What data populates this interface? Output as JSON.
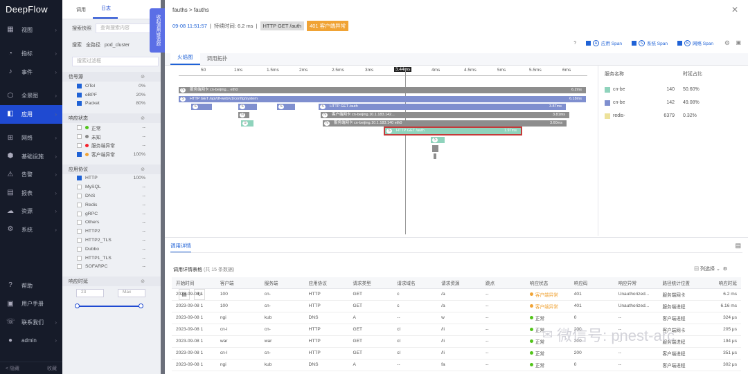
{
  "nav": {
    "logo": "DeepFlow",
    "items": [
      {
        "label": "视图",
        "icon": "dashboard-icon",
        "active": false
      },
      {
        "label": "指标",
        "icon": "gauge-icon",
        "active": false
      },
      {
        "label": "事件",
        "icon": "bell-icon",
        "active": false
      },
      {
        "label": "全景图",
        "icon": "graph-icon",
        "active": false
      },
      {
        "label": "应用",
        "icon": "app-icon",
        "active": true
      },
      {
        "label": "网络",
        "icon": "network-icon",
        "active": false
      },
      {
        "label": "基础设施",
        "icon": "cube-icon",
        "active": false
      },
      {
        "label": "告警",
        "icon": "warning-icon",
        "active": false
      },
      {
        "label": "报表",
        "icon": "report-icon",
        "active": false
      },
      {
        "label": "资源",
        "icon": "cloud-icon",
        "active": false
      },
      {
        "label": "系统",
        "icon": "gear-icon",
        "active": false
      }
    ],
    "bottom": [
      {
        "label": "帮助",
        "icon": "help-icon"
      },
      {
        "label": "用户手册",
        "icon": "book-icon"
      },
      {
        "label": "联系我们",
        "icon": "contact-icon"
      },
      {
        "label": "admin",
        "icon": "user-icon"
      }
    ],
    "footer_left": "< 隐藏",
    "footer_right": "收藏"
  },
  "filter": {
    "tabs": [
      "调用",
      "日志"
    ],
    "search_label": "搜索快照",
    "search_placeholder": "查询搜索内容",
    "group_label": "搜索",
    "group_path": "全路径",
    "group_value": "pod_cluster",
    "quick_placeholder": "搜索过滤框",
    "sections": [
      {
        "title": "信号源",
        "items": [
          {
            "label": "OTel",
            "pct": "0%",
            "checked": true
          },
          {
            "label": "eBPF",
            "pct": "20%",
            "checked": true
          },
          {
            "label": "Packet",
            "pct": "80%",
            "checked": true
          }
        ]
      },
      {
        "title": "响应状态",
        "items": [
          {
            "label": "正常",
            "pct": "--",
            "dot": "#52c41a"
          },
          {
            "label": "未知",
            "pct": "--",
            "dot": "#888888"
          },
          {
            "label": "服务端异常",
            "pct": "--",
            "dot": "#f5222d"
          },
          {
            "label": "客户端异常",
            "pct": "100%",
            "dot": "#f0a335",
            "checked": true
          }
        ]
      },
      {
        "title": "应用协议",
        "items": [
          {
            "label": "HTTP",
            "pct": "100%",
            "checked": true
          },
          {
            "label": "MySQL",
            "pct": "--"
          },
          {
            "label": "DNS",
            "pct": "--"
          },
          {
            "label": "Redis",
            "pct": "--"
          },
          {
            "label": "gRPC",
            "pct": "--"
          },
          {
            "label": "Others",
            "pct": "--"
          },
          {
            "label": "HTTP2",
            "pct": "--"
          },
          {
            "label": "HTTP2_TLS",
            "pct": "--"
          },
          {
            "label": "Dubbo",
            "pct": "--"
          },
          {
            "label": "HTTP1_TLS",
            "pct": "--"
          },
          {
            "label": "SOFARPC",
            "pct": "--"
          }
        ]
      },
      {
        "title": "响应时延",
        "items": []
      }
    ],
    "latency_min": "23",
    "latency_max": "Max"
  },
  "drawer_toggle": "收起调用链追踪",
  "panel": {
    "crumb": "fauths > fauths",
    "timestamp": "09-08 11:51:57",
    "duration": "持续时间: 6.2 ms",
    "request": "HTTP GET /auth",
    "status": "401 客户端异常",
    "legend": [
      {
        "badge": "A",
        "label": "应用 Span"
      },
      {
        "badge": "S",
        "label": "系统 Span"
      },
      {
        "badge": "N",
        "label": "网络 Span"
      }
    ],
    "tabs": [
      "火焰图",
      "调用拓扑"
    ],
    "ticks": [
      "50",
      "1ms",
      "1.5ms",
      "2ms",
      "2.5ms",
      "3ms",
      "3.44ms",
      "4ms",
      "4.5ms",
      "5ms",
      "5.5ms",
      "6ms"
    ],
    "bars": [
      {
        "badge": "N",
        "label": "服务端网卡 cn-beijing... eth0",
        "value": "6.2ms",
        "color": "gray"
      },
      {
        "badge": "S",
        "label": "HTTP GET /api/df-web/v1/config/system",
        "value": "6.18ms",
        "color": "blue"
      },
      {
        "badge": "S",
        "label": "",
        "value": "",
        "color": "blue"
      },
      {
        "badge": "S",
        "label": "",
        "value": "",
        "color": "blue"
      },
      {
        "badge": "S",
        "label": "",
        "value": "",
        "color": "blue"
      },
      {
        "badge": "S",
        "label": "HTTP GET /auth",
        "value": "3.87ms",
        "color": "blue"
      },
      {
        "badge": "N",
        "label": "",
        "value": "",
        "color": "gray"
      },
      {
        "badge": "N",
        "label": "客户端网卡 cn-beijing.10.1.183.142...",
        "value": "3.81ms",
        "color": "gray"
      },
      {
        "badge": "S",
        "label": "",
        "value": "",
        "color": "green"
      },
      {
        "badge": "N",
        "label": "服务端网卡 cn-beijing.10.1.183.140 eth0",
        "value": "3.60ms",
        "color": "gray"
      },
      {
        "badge": "S",
        "label": "HTTP GET /auth",
        "value": "1.97ms",
        "color": "green"
      },
      {
        "badge": "S",
        "label": "",
        "value": "",
        "color": "green"
      }
    ],
    "svc_headers": [
      "服务名称",
      "时延占比"
    ],
    "services": [
      {
        "name": "cn-be",
        "port": "140",
        "pct": "50.60%",
        "color": "#8fd3bc"
      },
      {
        "name": "cn-be",
        "port": "142",
        "pct": "49.08%",
        "color": "#7f8fcf"
      },
      {
        "name": "redis-",
        "port": "6379",
        "pct": "0.32%",
        "color": "#ede29b"
      }
    ],
    "detail_tab": "调用详情",
    "table_title": "调用详情表格",
    "table_count": "(共 15 条数据)",
    "column_select": "列选择",
    "columns": [
      "开始时间",
      "客户端",
      "服务端",
      "应用协议",
      "请求类型",
      "请求域名",
      "请求资源",
      "跳点",
      "响应状态",
      "响应码",
      "响应异常",
      "路径统计位置",
      "响应时延"
    ],
    "rows": [
      [
        "2023-09-08 1",
        "100",
        "cn-",
        "HTTP",
        "GET",
        "c",
        "/a",
        "--",
        "客户端异常",
        "401",
        "Unauthorized...",
        "服务端网卡",
        "6.2 ms"
      ],
      [
        "2023-09-08 1",
        "100",
        "cn-",
        "HTTP",
        "GET",
        "c",
        "/a",
        "--",
        "客户端异常",
        "401",
        "Unauthorized...",
        "服务端进程",
        "6.16 ms"
      ],
      [
        "2023-09-08 1",
        "ngi",
        "kub",
        "DNS",
        "A",
        "--",
        "w",
        "--",
        "正常",
        "0",
        "--",
        "客户端进程",
        "324 μs"
      ],
      [
        "2023-09-08 1",
        "cn-l",
        "cn-",
        "HTTP",
        "GET",
        "cl",
        "/li",
        "--",
        "正常",
        "200",
        "--",
        "客户端网卡",
        "205 μs"
      ],
      [
        "2023-09-08 1",
        "war",
        "war",
        "HTTP",
        "GET",
        "cl",
        "/li",
        "--",
        "正常",
        "200",
        "--",
        "服务端进程",
        "194 μs"
      ],
      [
        "2023-09-08 1",
        "cn-l",
        "cn-",
        "HTTP",
        "GET",
        "cl",
        "/li",
        "--",
        "正常",
        "200",
        "--",
        "客户端进程",
        "351 μs"
      ],
      [
        "2023-09-08 1",
        "ngi",
        "kub",
        "DNS",
        "A",
        "--",
        "fa",
        "--",
        "正常",
        "0",
        "--",
        "客户端进程",
        "302 μs"
      ]
    ]
  },
  "watermark": "微信号: pnest-arc",
  "colors": {
    "accent": "#1f62d6",
    "warning": "#f0a335",
    "ok": "#52c41a",
    "nav_bg": "#161b29"
  }
}
